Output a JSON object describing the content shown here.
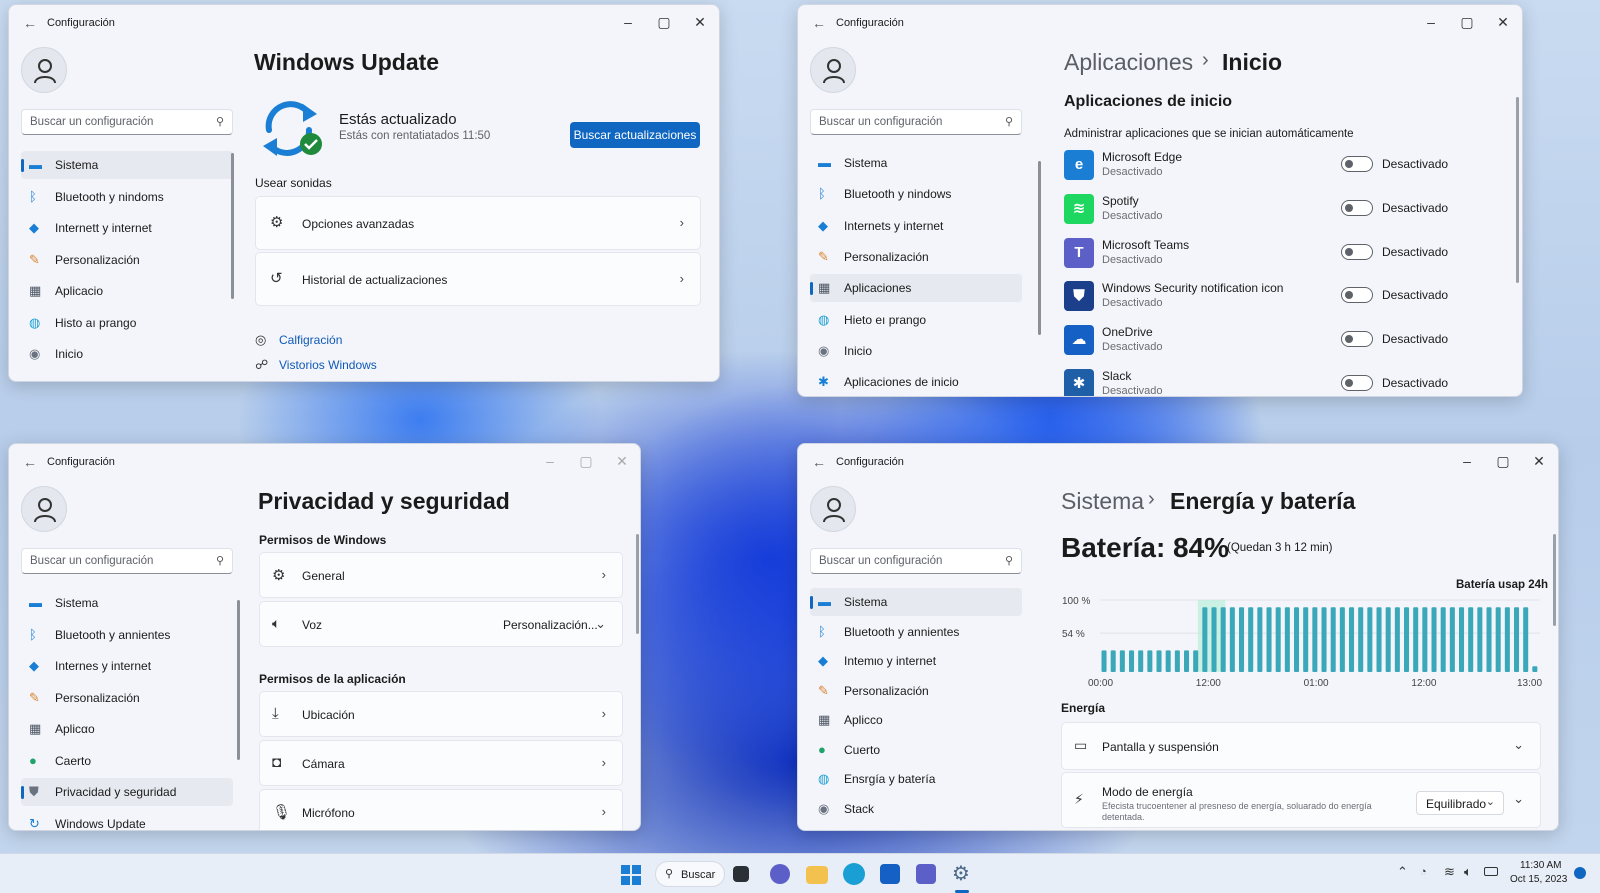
{
  "colors": {
    "accent": "#0f67c2",
    "link": "#0f5ab8",
    "toggle_off": "#5e6269",
    "battery_bar": "#3aa8b8",
    "battery_highlight": "#b8f0d8"
  },
  "windows": {
    "update": {
      "title": "Configuración",
      "search_placeholder": "Buscar un configuración",
      "nav": [
        {
          "label": "Sistema",
          "icon": "monitor-icon"
        },
        {
          "label": "Bluetooth y nindoms",
          "icon": "bluetooth-icon"
        },
        {
          "label": "Internett y internet",
          "icon": "wifi-icon"
        },
        {
          "label": "Personalización",
          "icon": "brush-icon"
        },
        {
          "label": "Aplicacio",
          "icon": "apps-icon"
        },
        {
          "label": "Histo aı prango",
          "icon": "globe-icon"
        },
        {
          "label": "Inicio",
          "icon": "gamepad-icon"
        }
      ],
      "heading": "Windows Update",
      "status_title": "Estás actualizado",
      "status_sub": "Estás con rentatiatados 11:50",
      "check_button": "Buscar actualizaciones",
      "section": "Usear sonidas",
      "cards": [
        {
          "label": "Opciones avanzadas",
          "icon": "gears-icon"
        },
        {
          "label": "Historial de actualizaciones",
          "icon": "history-icon"
        }
      ],
      "links": [
        {
          "label": "Calfigración",
          "icon": "help-icon"
        },
        {
          "label": "Vistorios Windows",
          "icon": "feedback-icon"
        }
      ]
    },
    "startup": {
      "title": "Configuración",
      "search_placeholder": "Buscar un configuración",
      "nav": [
        {
          "label": "Sistema",
          "icon": "monitor-icon"
        },
        {
          "label": "Bluetooth y nindows",
          "icon": "bluetooth-icon"
        },
        {
          "label": "Internets y internet",
          "icon": "wifi-icon"
        },
        {
          "label": "Personalización",
          "icon": "brush-icon"
        },
        {
          "label": "Aplicaciones",
          "icon": "apps-icon"
        },
        {
          "label": "Hieto eı prango",
          "icon": "globe-icon"
        },
        {
          "label": "Inicio",
          "icon": "gamepad-icon"
        },
        {
          "label": "Aplicaciones de inicio",
          "icon": "accessibility-icon"
        }
      ],
      "breadcrumb_parent": "Aplicaciones",
      "breadcrumb_sep": "›",
      "breadcrumb_current": "Inicio",
      "subheading": "Aplicaciones de inicio",
      "description": "Administrar aplicaciones que se inician automáticamente",
      "apps": [
        {
          "name": "Microsoft Edge",
          "status": "Desactivado",
          "toggle": "Desactivado",
          "icon": "edge-icon",
          "color": "#1a7fd4"
        },
        {
          "name": "Spotify",
          "status": "Desactivado",
          "toggle": "Desactivado",
          "icon": "spotify-icon",
          "color": "#1ed760"
        },
        {
          "name": "Microsoft Teams",
          "status": "Desactivado",
          "toggle": "Desactivado",
          "icon": "teams-icon",
          "color": "#5b5fc7"
        },
        {
          "name": "Windows Security notification icon",
          "status": "Desactivado",
          "toggle": "Desactivado",
          "icon": "shield-icon",
          "color": "#1b3f8a"
        },
        {
          "name": "OneDrive",
          "status": "Desactivado",
          "toggle": "Desactivado",
          "icon": "onedrive-icon",
          "color": "#1560c4"
        },
        {
          "name": "Slack",
          "status": "Desactivado",
          "toggle": "Desactivado",
          "icon": "slack-icon",
          "color": "#1f5fa8"
        }
      ]
    },
    "privacy": {
      "title": "Configuración",
      "search_placeholder": "Buscar un configuración",
      "nav": [
        {
          "label": "Sistema",
          "icon": "monitor-icon"
        },
        {
          "label": "Bluetooth y annientes",
          "icon": "bluetooth-icon"
        },
        {
          "label": "Internes y internet",
          "icon": "wifi-icon"
        },
        {
          "label": "Personalización",
          "icon": "brush-icon"
        },
        {
          "label": "Aplicαo",
          "icon": "apps-icon"
        },
        {
          "label": "Caerto",
          "icon": "person-icon"
        },
        {
          "label": "Privacidad y seguridad",
          "icon": "shield-icon"
        },
        {
          "label": "Windows Update",
          "icon": "update-icon"
        }
      ],
      "heading": "Privacidad y seguridad",
      "section_windows": "Permisos de Windows",
      "general": "General",
      "voz": "Voz",
      "voz_value": "Personalización...",
      "section_app": "Permisos de la aplicación",
      "app_perms": [
        {
          "label": "Ubicación",
          "icon": "download-icon"
        },
        {
          "label": "Cámara",
          "icon": "camera-icon"
        },
        {
          "label": "Micrófono",
          "icon": "microphone-icon"
        }
      ]
    },
    "battery": {
      "title": "Configuración",
      "search_placeholder": "Buscar un configuración",
      "nav": [
        {
          "label": "Sistema",
          "icon": "monitor-icon"
        },
        {
          "label": "Bluetooth y annientes",
          "icon": "bluetooth-icon"
        },
        {
          "label": "Intemιo y internet",
          "icon": "wifi-icon"
        },
        {
          "label": "Personalización",
          "icon": "brush-icon"
        },
        {
          "label": "Aplicco",
          "icon": "apps-icon"
        },
        {
          "label": "Cuerto",
          "icon": "person-icon"
        },
        {
          "label": "Ensrgía y batería",
          "icon": "globe-icon"
        },
        {
          "label": "Stack",
          "icon": "gamepad-icon"
        }
      ],
      "breadcrumb_parent": "Sistema",
      "breadcrumb_sep": "›",
      "breadcrumb_current": "Energía y batería",
      "battery_label": "Batería: 84%",
      "battery_remaining": "(Quedan 3 h 12 min)",
      "usage_label": "Batería usap 24h",
      "section_energy": "Energía",
      "screen_sleep": "Pantalla y suspensión",
      "power_mode": "Modo de energía",
      "power_mode_desc": "Efecista trucoentener al presneso de energía, soluarado do energía detentada.",
      "power_mode_value": "Equilibrado"
    }
  },
  "chart_data": {
    "type": "bar",
    "title": "Batería usap 24h",
    "y_ticks": [
      "100 %",
      "54 %"
    ],
    "x_ticks": [
      "00:00",
      "12:00",
      "01:00",
      "12:00",
      "13:00"
    ],
    "ylim": [
      0,
      100
    ],
    "values": [
      30,
      30,
      30,
      30,
      30,
      30,
      30,
      30,
      30,
      30,
      30,
      90,
      90,
      90,
      90,
      90,
      90,
      90,
      90,
      90,
      90,
      90,
      90,
      90,
      90,
      90,
      90,
      90,
      90,
      90,
      90,
      90,
      90,
      90,
      90,
      90,
      90,
      90,
      90,
      90,
      90,
      90,
      90,
      90,
      90,
      90,
      90,
      8
    ]
  },
  "taskbar": {
    "search_label": "Buscar",
    "time": "11:30 AM",
    "date": "Oct 15, 2023"
  }
}
